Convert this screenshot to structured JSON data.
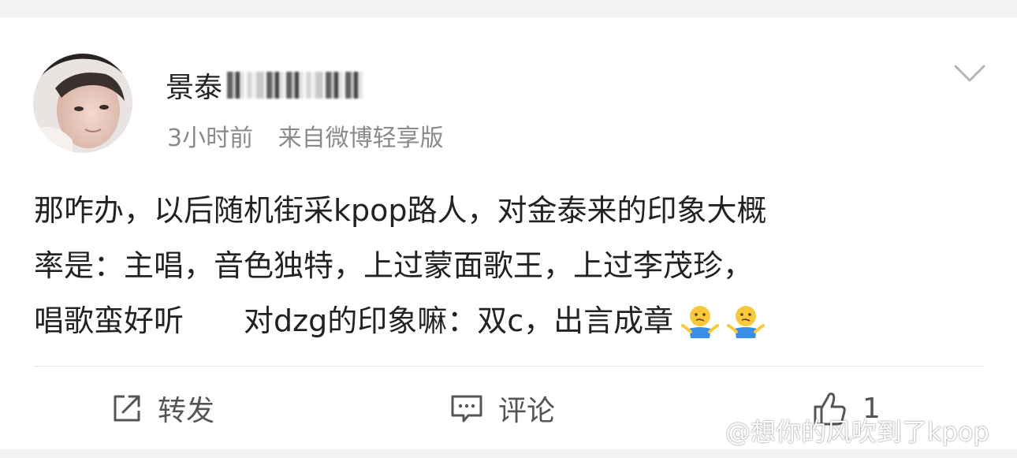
{
  "post": {
    "username_visible": "景泰",
    "time": "3小时前",
    "source": "来自微博轻享版",
    "content_lines": [
      "那咋办，以后随机街采kpop路人，对金泰来的印象大概",
      "率是：主唱，音色独特，上过蒙面歌王，上过李茂珍，"
    ],
    "content_line3_a": "唱歌蛮好听",
    "content_line3_b": "对dzg的印象嘛：双c，出言成章",
    "emojis": [
      "shrug-emoji",
      "shrug-emoji"
    ]
  },
  "actions": {
    "repost_label": "转发",
    "comment_label": "评论",
    "like_count": "1"
  },
  "watermark": {
    "text": "@想你的风吹到了kpop"
  },
  "colors": {
    "background": "#f2f2f2",
    "card": "#ffffff",
    "text_primary": "#222222",
    "text_secondary": "#8a8a8a",
    "divider": "#e6e6e6"
  },
  "icons": {
    "more": "chevron-down-icon",
    "repost": "repost-icon",
    "comment": "comment-icon",
    "like": "thumbs-up-icon",
    "watermark_logo": "weibo-logo-icon"
  }
}
